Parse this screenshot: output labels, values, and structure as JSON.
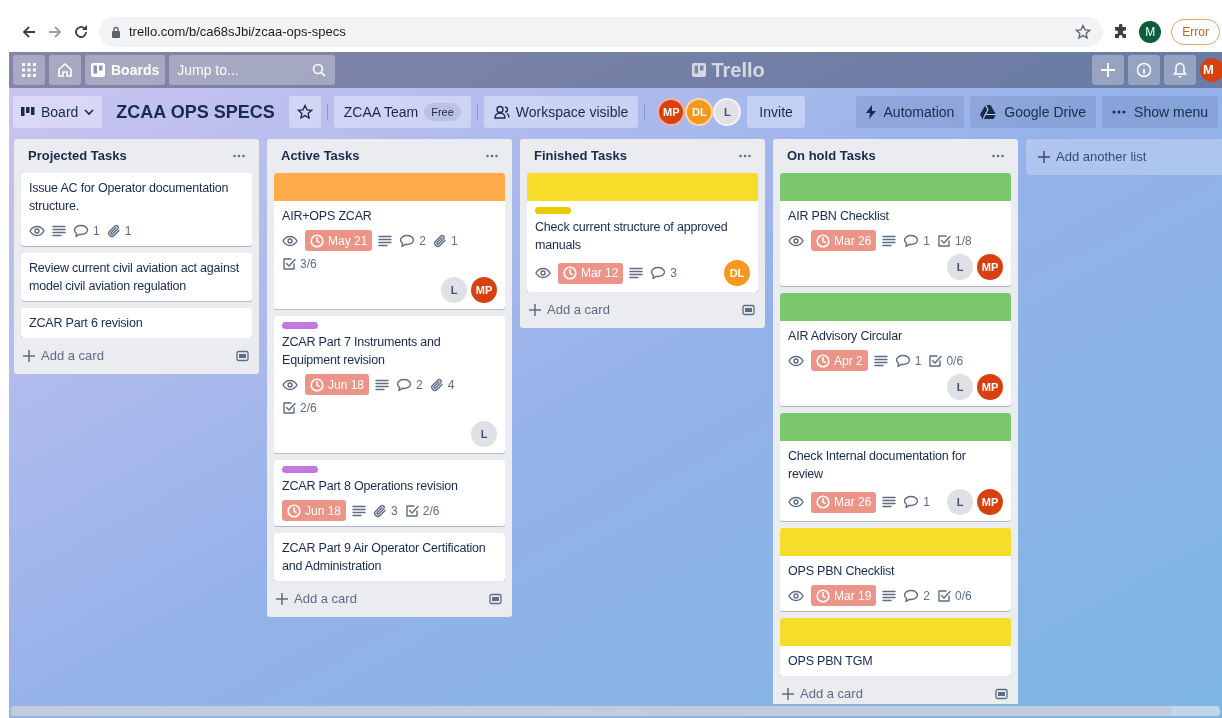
{
  "browser": {
    "url": "trello.com/b/ca68sJbi/zcaa-ops-specs",
    "profile": "M",
    "error_button": "Error"
  },
  "header": {
    "boards": "Boards",
    "search_placeholder": "Jump to...",
    "logo": "Trello",
    "avatar": "M"
  },
  "board_bar": {
    "view": "Board",
    "title": "ZCAA OPS SPECS",
    "team": "ZCAA Team",
    "team_badge": "Free",
    "visibility": "Workspace visible",
    "members": [
      {
        "initials": "MP",
        "color": "#d9400f"
      },
      {
        "initials": "DL",
        "color": "#f7981e"
      },
      {
        "initials": "L",
        "color": "#dfe1e6"
      }
    ],
    "invite": "Invite",
    "actions": [
      {
        "kind": "automation",
        "label": "Automation"
      },
      {
        "kind": "drive",
        "label": "Google Drive"
      },
      {
        "kind": "menu",
        "label": "Show menu"
      }
    ]
  },
  "lists": [
    {
      "title": "Projected Tasks",
      "add_card": "Add a card",
      "cards": [
        {
          "title": "Issue AC for Operator documentation structure.",
          "badges": [
            {
              "kind": "watch"
            },
            {
              "kind": "description"
            },
            {
              "kind": "comments",
              "text": "1"
            },
            {
              "kind": "attachments",
              "text": "1"
            }
          ]
        },
        {
          "title": "Review current civil aviation act against model civil aviation regulation"
        },
        {
          "title": "ZCAR Part 6 revision"
        }
      ]
    },
    {
      "title": "Active Tasks",
      "add_card": "Add a card",
      "cards": [
        {
          "cover": {
            "color": "#ffab4a"
          },
          "title": "AIR+OPS ZCAR",
          "badges": [
            {
              "kind": "watch"
            },
            {
              "kind": "due",
              "text": "May 21"
            },
            {
              "kind": "description"
            },
            {
              "kind": "comments",
              "text": "2"
            },
            {
              "kind": "attachments",
              "text": "1"
            },
            {
              "kind": "checklist",
              "text": "3/6"
            }
          ],
          "members": [
            {
              "initials": "L",
              "color": "#dfe1e6"
            },
            {
              "initials": "MP",
              "color": "#d9400f"
            }
          ]
        },
        {
          "label": {
            "color": "#c377e0"
          },
          "title": "ZCAR Part 7 Instruments and Equipment revision",
          "badges": [
            {
              "kind": "watch"
            },
            {
              "kind": "due",
              "text": "Jun 18"
            },
            {
              "kind": "description"
            },
            {
              "kind": "comments",
              "text": "2"
            },
            {
              "kind": "attachments",
              "text": "4"
            },
            {
              "kind": "checklist",
              "text": "2/6"
            }
          ],
          "members": [
            {
              "initials": "L",
              "color": "#dfe1e6"
            }
          ]
        },
        {
          "label": {
            "color": "#c377e0"
          },
          "title": "ZCAR Part 8 Operations revision",
          "badges": [
            {
              "kind": "due",
              "text": "Jun 18"
            },
            {
              "kind": "description"
            },
            {
              "kind": "attachments",
              "text": "3"
            },
            {
              "kind": "checklist",
              "text": "2/6"
            }
          ]
        },
        {
          "title": "ZCAR Part 9 Air Operator Certification and Administration"
        }
      ]
    },
    {
      "title": "Finished Tasks",
      "add_card": "Add a card",
      "cards": [
        {
          "cover": {
            "color": "#f5dd29"
          },
          "label": {
            "color": "#e8cc00"
          },
          "title": "Check current structure of approved manuals",
          "badges": [
            {
              "kind": "watch"
            },
            {
              "kind": "due",
              "text": "Mar 12"
            },
            {
              "kind": "description"
            },
            {
              "kind": "comments",
              "text": "3"
            }
          ],
          "members": [
            {
              "initials": "DL",
              "color": "#f7981e"
            }
          ]
        }
      ]
    },
    {
      "title": "On hold Tasks",
      "add_card": "Add a card",
      "cards": [
        {
          "cover": {
            "color": "#7bc86c"
          },
          "title": "AIR PBN Checklist",
          "badges": [
            {
              "kind": "watch"
            },
            {
              "kind": "due",
              "text": "Mar 26"
            },
            {
              "kind": "description"
            },
            {
              "kind": "comments",
              "text": "1"
            },
            {
              "kind": "checklist",
              "text": "1/8"
            }
          ],
          "members": [
            {
              "initials": "L",
              "color": "#dfe1e6"
            },
            {
              "initials": "MP",
              "color": "#d9400f"
            }
          ]
        },
        {
          "cover": {
            "color": "#7bc86c"
          },
          "title": "AIR Advisory Circular",
          "badges": [
            {
              "kind": "watch"
            },
            {
              "kind": "due",
              "text": "Apr 2"
            },
            {
              "kind": "description"
            },
            {
              "kind": "comments",
              "text": "1"
            },
            {
              "kind": "checklist",
              "text": "0/6"
            }
          ],
          "members": [
            {
              "initials": "L",
              "color": "#dfe1e6"
            },
            {
              "initials": "MP",
              "color": "#d9400f"
            }
          ]
        },
        {
          "cover": {
            "color": "#7bc86c"
          },
          "title": "Check Internal documentation for review",
          "badges": [
            {
              "kind": "watch"
            },
            {
              "kind": "due",
              "text": "Mar 26"
            },
            {
              "kind": "description"
            },
            {
              "kind": "comments",
              "text": "1"
            }
          ],
          "members": [
            {
              "initials": "L",
              "color": "#dfe1e6"
            },
            {
              "initials": "MP",
              "color": "#d9400f"
            }
          ]
        },
        {
          "cover": {
            "color": "#f5dd29"
          },
          "title": "OPS PBN Checklist",
          "badges": [
            {
              "kind": "watch"
            },
            {
              "kind": "due",
              "text": "Mar 19"
            },
            {
              "kind": "description"
            },
            {
              "kind": "comments",
              "text": "2"
            },
            {
              "kind": "checklist",
              "text": "0/6"
            }
          ]
        },
        {
          "cover": {
            "color": "#f5dd29"
          },
          "title": "OPS PBN TGM"
        }
      ]
    }
  ],
  "add_list": "Add another list"
}
